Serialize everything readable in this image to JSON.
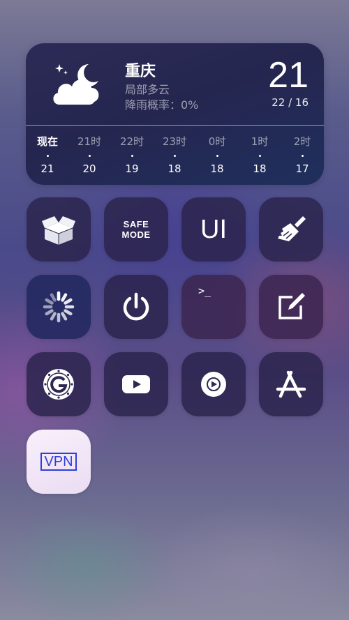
{
  "weather": {
    "city": "重庆",
    "condition": "局部多云",
    "rain_chance": "降雨概率：0%",
    "temp_now": "21",
    "temp_range": "22 / 16",
    "icon": "partly-cloudy-night-icon",
    "hours": [
      {
        "label": "现在",
        "temp": "21"
      },
      {
        "label": "21时",
        "temp": "20"
      },
      {
        "label": "22时",
        "temp": "19"
      },
      {
        "label": "23时",
        "temp": "18"
      },
      {
        "label": "0时",
        "temp": "18"
      },
      {
        "label": "1时",
        "temp": "18"
      },
      {
        "label": "2时",
        "temp": "17"
      }
    ]
  },
  "tiles": {
    "safe_mode": {
      "line1": "SAFE",
      "line2": "MODE"
    },
    "ui": {
      "label": "UI"
    },
    "terminal": {
      "prompt": ">_"
    },
    "vpn": {
      "label": "VPN"
    },
    "icons": [
      "package-box-icon",
      "safe-mode-icon",
      "ui-icon",
      "broom-clean-icon",
      "loading-spinner-icon",
      "power-icon",
      "terminal-icon",
      "edit-note-icon",
      "g-dial-icon",
      "youtube-icon",
      "play-circle-icon",
      "app-store-icon",
      "vpn-icon"
    ]
  }
}
